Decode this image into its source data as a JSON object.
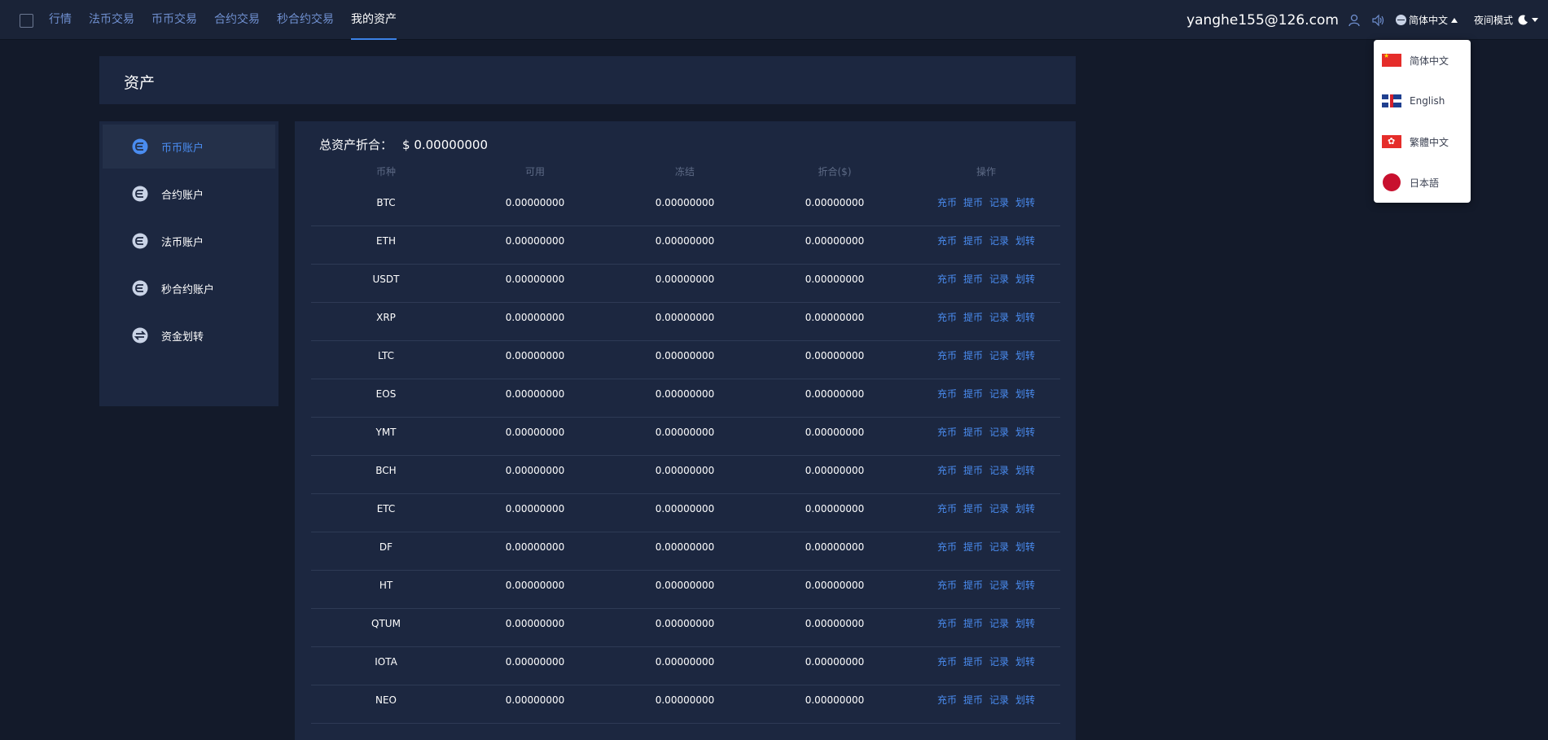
{
  "nav": {
    "items": [
      {
        "label": "行情",
        "active": false
      },
      {
        "label": "法币交易",
        "active": false
      },
      {
        "label": "币币交易",
        "active": false
      },
      {
        "label": "合约交易",
        "active": false
      },
      {
        "label": "秒合约交易",
        "active": false
      },
      {
        "label": "我的资产",
        "active": true
      }
    ],
    "user_email": "yanghe155@126.com",
    "language": "简体中文",
    "night_mode": "夜间模式"
  },
  "lang_menu": {
    "options": [
      {
        "label": "简体中文",
        "flag": "china-flag-icon"
      },
      {
        "label": "English",
        "flag": "uk-flag-icon"
      },
      {
        "label": "繁體中文",
        "flag": "hongkong-flag-icon"
      },
      {
        "label": "日本語",
        "flag": "japan-flag-icon"
      }
    ]
  },
  "page": {
    "title": "资产"
  },
  "sidebar": {
    "items": [
      {
        "label": "币币账户",
        "icon": "coin-icon",
        "active": true
      },
      {
        "label": "合约账户",
        "icon": "coin-icon",
        "active": false
      },
      {
        "label": "法币账户",
        "icon": "coin-icon",
        "active": false
      },
      {
        "label": "秒合约账户",
        "icon": "coin-icon",
        "active": false
      },
      {
        "label": "资金划转",
        "icon": "transfer-icon",
        "active": false
      }
    ]
  },
  "assets": {
    "total_label": "总资产折合：",
    "total_value": "$ 0.00000000",
    "columns": [
      "币种",
      "可用",
      "冻结",
      "折合($)",
      "操作"
    ],
    "actions": [
      "充币",
      "提币",
      "记录",
      "划转"
    ],
    "rows": [
      {
        "coin": "BTC",
        "available": "0.00000000",
        "frozen": "0.00000000",
        "usd": "0.00000000"
      },
      {
        "coin": "ETH",
        "available": "0.00000000",
        "frozen": "0.00000000",
        "usd": "0.00000000"
      },
      {
        "coin": "USDT",
        "available": "0.00000000",
        "frozen": "0.00000000",
        "usd": "0.00000000"
      },
      {
        "coin": "XRP",
        "available": "0.00000000",
        "frozen": "0.00000000",
        "usd": "0.00000000"
      },
      {
        "coin": "LTC",
        "available": "0.00000000",
        "frozen": "0.00000000",
        "usd": "0.00000000"
      },
      {
        "coin": "EOS",
        "available": "0.00000000",
        "frozen": "0.00000000",
        "usd": "0.00000000"
      },
      {
        "coin": "YMT",
        "available": "0.00000000",
        "frozen": "0.00000000",
        "usd": "0.00000000"
      },
      {
        "coin": "BCH",
        "available": "0.00000000",
        "frozen": "0.00000000",
        "usd": "0.00000000"
      },
      {
        "coin": "ETC",
        "available": "0.00000000",
        "frozen": "0.00000000",
        "usd": "0.00000000"
      },
      {
        "coin": "DF",
        "available": "0.00000000",
        "frozen": "0.00000000",
        "usd": "0.00000000"
      },
      {
        "coin": "HT",
        "available": "0.00000000",
        "frozen": "0.00000000",
        "usd": "0.00000000"
      },
      {
        "coin": "QTUM",
        "available": "0.00000000",
        "frozen": "0.00000000",
        "usd": "0.00000000"
      },
      {
        "coin": "IOTA",
        "available": "0.00000000",
        "frozen": "0.00000000",
        "usd": "0.00000000"
      },
      {
        "coin": "NEO",
        "available": "0.00000000",
        "frozen": "0.00000000",
        "usd": "0.00000000"
      }
    ]
  },
  "colors": {
    "accent": "#4a8cf0",
    "background": "#131a2a",
    "panel": "#1c2740"
  }
}
